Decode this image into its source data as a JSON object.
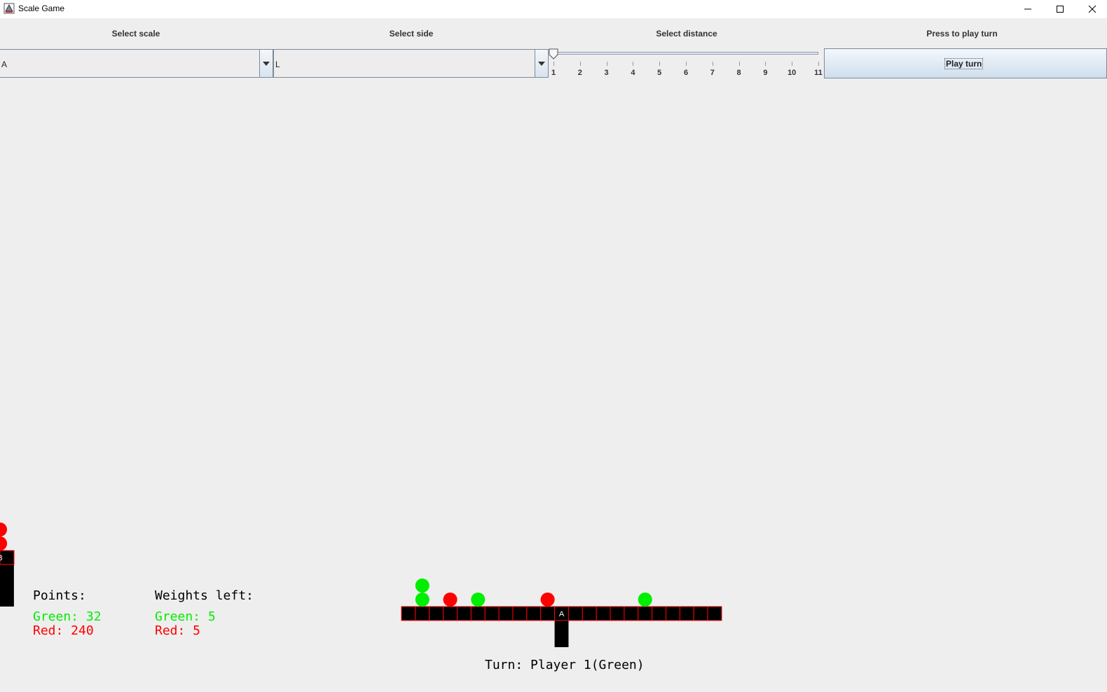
{
  "window": {
    "title": "Scale Game",
    "icon": "java-app-icon",
    "controls": [
      "minimize-icon",
      "maximize-icon",
      "close-icon"
    ]
  },
  "controls": {
    "scale": {
      "label": "Select scale",
      "value": "A"
    },
    "side": {
      "label": "Select side",
      "value": "L"
    },
    "distance": {
      "label": "Select distance",
      "value": 1,
      "min": 1,
      "max": 11,
      "ticks": [
        "1",
        "2",
        "3",
        "4",
        "5",
        "6",
        "7",
        "8",
        "9",
        "10",
        "11"
      ]
    },
    "play": {
      "label": "Press to play turn",
      "button": "Play turn"
    }
  },
  "points": {
    "heading": "Points:",
    "green": "Green: 32",
    "red": "Red: 240"
  },
  "weights_left": {
    "heading": "Weights left:",
    "green": "Green: 5",
    "red": "Red: 5"
  },
  "turn": "Turn: Player 1(Green)",
  "colors": {
    "green": "#00ee00",
    "red": "#ff0000",
    "beam": "#000000",
    "beam_border": "#ff0000"
  },
  "scales": [
    {
      "name": "A",
      "length": 23,
      "pivot_slot": 11,
      "weights": [
        {
          "slot": 1,
          "stack": [
            "green",
            "green"
          ]
        },
        {
          "slot": 3,
          "stack": [
            "red"
          ]
        },
        {
          "slot": 5,
          "stack": [
            "green"
          ]
        },
        {
          "slot": 10,
          "stack": [
            "red"
          ]
        },
        {
          "slot": 17,
          "stack": [
            "green"
          ]
        }
      ]
    },
    {
      "name": "B",
      "length": 15,
      "pivot_slot": 7,
      "on_scale": "A",
      "on_slot": 22,
      "weights": [
        {
          "slot": 0,
          "stack": [
            "red"
          ]
        },
        {
          "slot": 14,
          "stack": [
            "red",
            "red"
          ]
        }
      ]
    }
  ]
}
